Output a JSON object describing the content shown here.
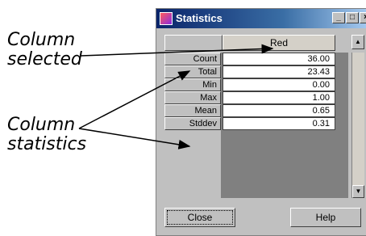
{
  "annotations": {
    "column_selected": [
      "Column",
      "selected"
    ],
    "column_statistics": [
      "Column",
      "statistics"
    ]
  },
  "window": {
    "title": "Statistics",
    "title_buttons": [
      "_",
      "□",
      "×"
    ]
  },
  "table": {
    "column_header": "Red",
    "rows": [
      {
        "label": "Count",
        "value": "36.00"
      },
      {
        "label": "Total",
        "value": "23.43"
      },
      {
        "label": "Min",
        "value": "0.00"
      },
      {
        "label": "Max",
        "value": "1.00"
      },
      {
        "label": "Mean",
        "value": "0.65"
      },
      {
        "label": "Stddev",
        "value": "0.31"
      }
    ]
  },
  "buttons": {
    "close": "Close",
    "help": "Help"
  },
  "colors": {
    "dialog_bg": "#c0c0c0",
    "title_bg": "#0a246a",
    "grid_bg": "#808080"
  }
}
